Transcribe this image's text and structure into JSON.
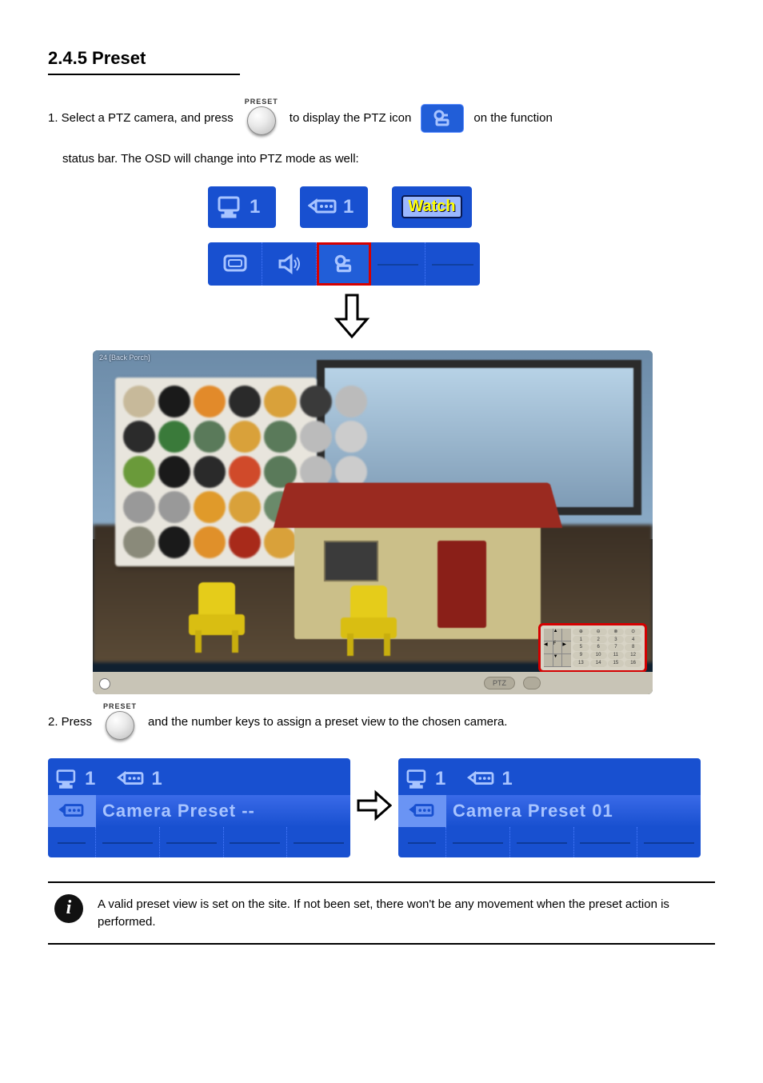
{
  "section_title": "2.4.5 Preset",
  "step1": {
    "prefix": "1. Select a PTZ camera, and press ",
    "preset_label": "PRESET",
    "after_button_a": " to display the PTZ icon ",
    "after_button_b": " on the function"
  },
  "step1_line2": "status bar. The OSD will change into PTZ mode as well:",
  "status": {
    "monitor_index": "1",
    "camera_index": "1",
    "watch": "Watch"
  },
  "preview": {
    "camera_label": "24 [Back Porch]",
    "ptz_pill": "PTZ",
    "ctrl_pill": ""
  },
  "step2": {
    "prefix": "2. Press ",
    "preset_label": "PRESET",
    "before_strips": " and the number keys to assign a preset view to the chosen camera."
  },
  "preset_strip_before": {
    "monitor_index": "1",
    "camera_index": "1",
    "label": "Camera Preset --"
  },
  "preset_strip_after": {
    "monitor_index": "1",
    "camera_index": "1",
    "label": "Camera Preset 01"
  },
  "note_text": "A valid preset view is set on the site. If not been set, there won't be any movement when the preset action is performed."
}
